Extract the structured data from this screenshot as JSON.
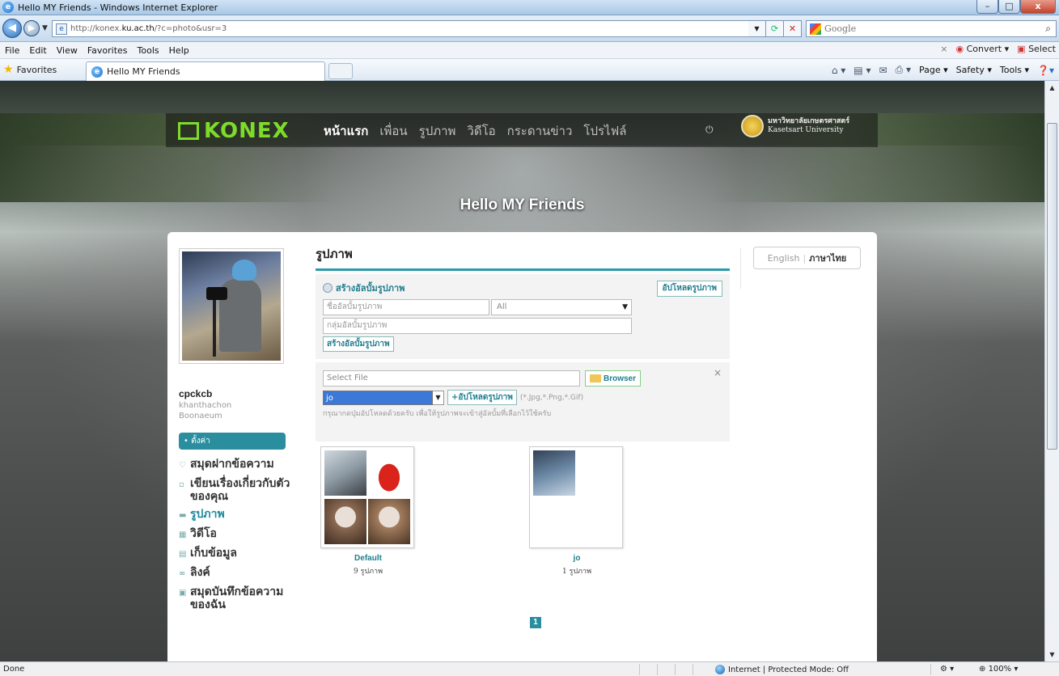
{
  "window": {
    "title": "Hello MY Friends - Windows Internet Explorer",
    "buttons": {
      "minimize": "–",
      "maximize": "□",
      "close": "x"
    }
  },
  "address": {
    "url_prefix": "http://konex.",
    "url_domain": "ku.ac.th",
    "url_suffix": "/?c=photo&usr=3",
    "search_placeholder": "Google"
  },
  "menu": {
    "items": [
      "File",
      "Edit",
      "View",
      "Favorites",
      "Tools",
      "Help"
    ],
    "convert": "Convert",
    "select": "Select"
  },
  "favbar": {
    "favorites": "Favorites",
    "tab_title": "Hello MY Friends",
    "commands": [
      "Page",
      "Safety",
      "Tools"
    ]
  },
  "site": {
    "logo": "KONEX",
    "nav": [
      "หน้าแรก",
      "เพื่อน",
      "รูปภาพ",
      "วิดีโอ",
      "กระดานข่าว",
      "โปรไฟล์"
    ],
    "university_th": "มหาวิทยาลัยเกษตรศาสตร์",
    "university_en": "Kasetsart University",
    "hero_title": "Hello MY Friends"
  },
  "profile": {
    "username": "cpckcb",
    "realname_line1": "khanthachon",
    "realname_line2": "Boonaeum",
    "settings": "• ตั้งค่า",
    "links": [
      {
        "label": "สมุดฝากข้อความ"
      },
      {
        "label": "เขียนเรื่องเกี่ยวกับตัวของคุณ"
      },
      {
        "label": "รูปภาพ"
      },
      {
        "label": "วิดีโอ"
      },
      {
        "label": "เก็บข้อมูล"
      },
      {
        "label": "ลิงค์"
      },
      {
        "label": "สมุดบันทึกข้อความของฉัน"
      }
    ]
  },
  "photos": {
    "section_title": "รูปภาพ",
    "create_heading": "สร้างอัลบั้มรูปภาพ",
    "upload_photo_btn": "อัปโหลดรูปภาพ",
    "album_name_placeholder": "ชื่ออัลบั้มรูปภาพ",
    "privacy_value": "All",
    "album_group_placeholder": "กลุ่มอัลบั้มรูปภาพ",
    "create_btn": "สร้างอัลบั้มรูปภาพ",
    "file_placeholder": "Select File",
    "browse_btn": "Browser",
    "album_select_value": "jo",
    "upload_btn": "+อัปโหลดรูปภาพ",
    "file_types": "(*.Jpg,*.Png,*.Gif)",
    "hint": "กรุณากดปุ่มอัปโหลดด้วยครับ เพื่อให้รูปภาพจะเข้าสู่อัลบั้มที่เลือกไว้ใช้ครับ",
    "close": "×",
    "albums": [
      {
        "name": "Default",
        "count": "9 รูปภาพ"
      },
      {
        "name": "jo",
        "count": "1 รูปภาพ"
      }
    ],
    "page": "1"
  },
  "lang": {
    "english": "English",
    "thai": "ภาษาไทย"
  },
  "status": {
    "left": "Done",
    "zone": "Internet | Protected Mode: Off",
    "zoom": "100%"
  }
}
